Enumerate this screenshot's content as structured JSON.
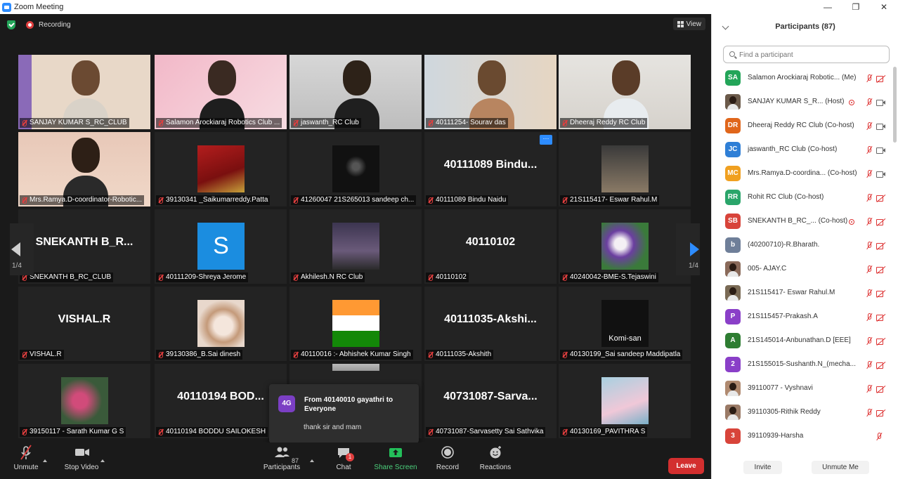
{
  "window": {
    "title": "Zoom Meeting",
    "controls": [
      "—",
      "❐",
      "✕"
    ]
  },
  "meeting": {
    "recording_label": "Recording",
    "view_label": "View",
    "page_indicator_left": "1/4",
    "page_indicator_right": "1/4",
    "tiles": [
      {
        "name": "SANJAY KUMAR S_RC_CLUB",
        "big": "",
        "type": "video",
        "active": true
      },
      {
        "name": "Salamon Arockiaraj Robotics Club ...",
        "big": "",
        "type": "video"
      },
      {
        "name": "jaswanth_RC Club",
        "big": "",
        "type": "video"
      },
      {
        "name": "40111254- Sourav das",
        "big": "",
        "type": "video"
      },
      {
        "name": "Dheeraj Reddy RC Club",
        "big": "",
        "type": "video"
      },
      {
        "name": "Mrs.Ramya.D-coordinator-Robotic...",
        "big": "",
        "type": "video"
      },
      {
        "name": "39130341 _Saikumarreddy.Patta",
        "big": "",
        "type": "photo"
      },
      {
        "name": "41260047 21S265013 sandeep ch...",
        "big": "",
        "type": "photo"
      },
      {
        "name": "40111089 Bindu Naidu",
        "big": "40111089  Bindu...",
        "type": "name"
      },
      {
        "name": "21S115417- Eswar Rahul.M",
        "big": "",
        "type": "photo"
      },
      {
        "name": "SNEKANTH B_RC_CLUB",
        "big": "SNEKANTH  B_R...",
        "type": "name"
      },
      {
        "name": "40111209-Shreya Jerome",
        "big": "S",
        "type": "letter"
      },
      {
        "name": "Akhilesh.N RC Club",
        "big": "",
        "type": "photo"
      },
      {
        "name": "40110102",
        "big": "40110102",
        "type": "name"
      },
      {
        "name": "40240042-BME-S.Tejaswini",
        "big": "",
        "type": "photo"
      },
      {
        "name": "VISHAL.R",
        "big": "VISHAL.R",
        "type": "name"
      },
      {
        "name": "39130386_B.Sai dinesh",
        "big": "",
        "type": "photo"
      },
      {
        "name": "40110016 :- Abhishek Kumar Singh",
        "big": "",
        "type": "photo"
      },
      {
        "name": "40111035-Akshith",
        "big": "40111035-Akshi...",
        "type": "name"
      },
      {
        "name": "40130199_Sai sandeep Maddipatla",
        "big": "Komi-san",
        "type": "photo"
      },
      {
        "name": "39150117 - Sarath Kumar G S",
        "big": "",
        "type": "photo"
      },
      {
        "name": "40110194 BODDU SAILOKESH",
        "big": "40110194  BOD...",
        "type": "name"
      },
      {
        "name": "",
        "big": "",
        "type": "photo"
      },
      {
        "name": "40731087-Sarvasetty Sai Sathvika",
        "big": "40731087-Sarva...",
        "type": "name"
      },
      {
        "name": "40130169_PAVITHRA S",
        "big": "",
        "type": "photo"
      }
    ]
  },
  "chat_popup": {
    "avatar": "4G",
    "from": "From 40140010 gayathri to Everyone",
    "message": "thank sir and mam"
  },
  "toolbar": {
    "unmute": "Unmute",
    "stop_video": "Stop Video",
    "participants": "Participants",
    "participants_count": "87",
    "chat": "Chat",
    "chat_badge": "1",
    "share_screen": "Share Screen",
    "record": "Record",
    "reactions": "Reactions",
    "leave": "Leave"
  },
  "panel": {
    "title": "Participants (87)",
    "search_placeholder": "Find a participant",
    "invite": "Invite",
    "unmute_me": "Unmute Me",
    "participants": [
      {
        "initials": "SA",
        "color": "#23a559",
        "name": "Salamon Arockiaraj Robotic... (Me)",
        "host_icon": false,
        "cam": "off"
      },
      {
        "initials": "",
        "color": "#6b5a4a",
        "name": "SANJAY KUMAR S_R...   (Host)",
        "host_icon": true,
        "cam": "on"
      },
      {
        "initials": "DR",
        "color": "#e0661b",
        "name": "Dheeraj Reddy RC Club (Co-host)",
        "host_icon": false,
        "cam": "on"
      },
      {
        "initials": "JC",
        "color": "#2f7fd6",
        "name": "jaswanth_RC Club (Co-host)",
        "host_icon": false,
        "cam": "on"
      },
      {
        "initials": "MC",
        "color": "#f0a020",
        "name": "Mrs.Ramya.D-coordina... (Co-host)",
        "host_icon": false,
        "cam": "on"
      },
      {
        "initials": "RR",
        "color": "#2aa56a",
        "name": "Rohit RC Club (Co-host)",
        "host_icon": false,
        "cam": "off"
      },
      {
        "initials": "SB",
        "color": "#d8443a",
        "name": "SNEKANTH B_RC_...     (Co-host)",
        "host_icon": true,
        "cam": "off"
      },
      {
        "initials": "b",
        "color": "#6f7f99",
        "name": "(40200710)-R.Bharath.",
        "host_icon": false,
        "cam": "off"
      },
      {
        "initials": "",
        "color": "#8a6a5a",
        "name": "005- AJAY.C",
        "host_icon": false,
        "cam": "off"
      },
      {
        "initials": "",
        "color": "#7a6a55",
        "name": "21S115417- Eswar Rahul.M",
        "host_icon": false,
        "cam": "off"
      },
      {
        "initials": "P",
        "color": "#8a3fc8",
        "name": "21S115457-Prakash.A",
        "host_icon": false,
        "cam": "off"
      },
      {
        "initials": "A",
        "color": "#2e7d32",
        "name": "21S145014-Anbunathan.D [EEE]",
        "host_icon": false,
        "cam": "off"
      },
      {
        "initials": "2",
        "color": "#8a3fc8",
        "name": "21S155015-Sushanth.N_(mecha...",
        "host_icon": false,
        "cam": "off"
      },
      {
        "initials": "",
        "color": "#b08a70",
        "name": "39110077 - Vyshnavi",
        "host_icon": false,
        "cam": "off"
      },
      {
        "initials": "",
        "color": "#9a7a66",
        "name": "39110305-Rithik Reddy",
        "host_icon": false,
        "cam": "off"
      },
      {
        "initials": "3",
        "color": "#d8443a",
        "name": "39110939-Harsha",
        "host_icon": false,
        "cam": "none"
      }
    ]
  }
}
